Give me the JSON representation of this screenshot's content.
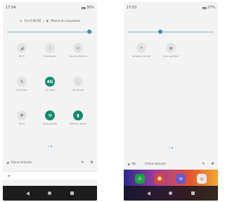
{
  "left_phone": {
    "status": {
      "time": "17:54",
      "battery": "35%"
    },
    "timer": {
      "label": "Tru 0:30:00",
      "mode": "Phone on coursaree"
    },
    "brightness_level": 0.98,
    "tiles": [
      {
        "label": "Wi-Fi",
        "icon": "wifi-icon",
        "glyph": "◢",
        "on": false
      },
      {
        "label": "Bluetooth",
        "icon": "bluetooth-icon",
        "glyph": "ᛒ",
        "on": false
      },
      {
        "label": "Do not disturb",
        "icon": "dnd-icon",
        "glyph": "⊖",
        "on": false
      },
      {
        "label": "Cell data",
        "icon": "cellular-data-icon",
        "glyph": "⇅",
        "on": false
      },
      {
        "label": "4G data",
        "icon": "4g-icon",
        "glyph": "4G",
        "on": true
      },
      {
        "label": "4G Shark",
        "icon": "data-saver-icon",
        "glyph": "◡",
        "on": false
      },
      {
        "label": "Torch",
        "icon": "flashlight-icon",
        "glyph": "▼",
        "on": false
      },
      {
        "label": "Auto-rotate",
        "icon": "auto-rotate-icon",
        "glyph": "⟲",
        "on": true
      },
      {
        "label": "Battery Saver",
        "icon": "battery-saver-icon",
        "glyph": "▮",
        "on": true
      }
    ],
    "network": "China Unicom",
    "edit_icon": "pencil-icon",
    "settings_icon": "gear-icon"
  },
  "right_phone": {
    "status": {
      "time": "17:53",
      "battery": "27%"
    },
    "brightness_level": 0.37,
    "tiles": [
      {
        "label": "Airplane mode",
        "icon": "airplane-icon",
        "glyph": "✈",
        "on": false
      },
      {
        "label": "Eye comfort",
        "icon": "eye-comfort-icon",
        "glyph": "◉",
        "on": false
      }
    ],
    "network_left": "Ab",
    "network": "China Unicom",
    "edit_icon": "pencil-icon",
    "settings_icon": "gear-icon"
  },
  "colors": {
    "accent": "#14896e",
    "slider": "#3a8ea9",
    "nav": "#1d1d1d"
  }
}
